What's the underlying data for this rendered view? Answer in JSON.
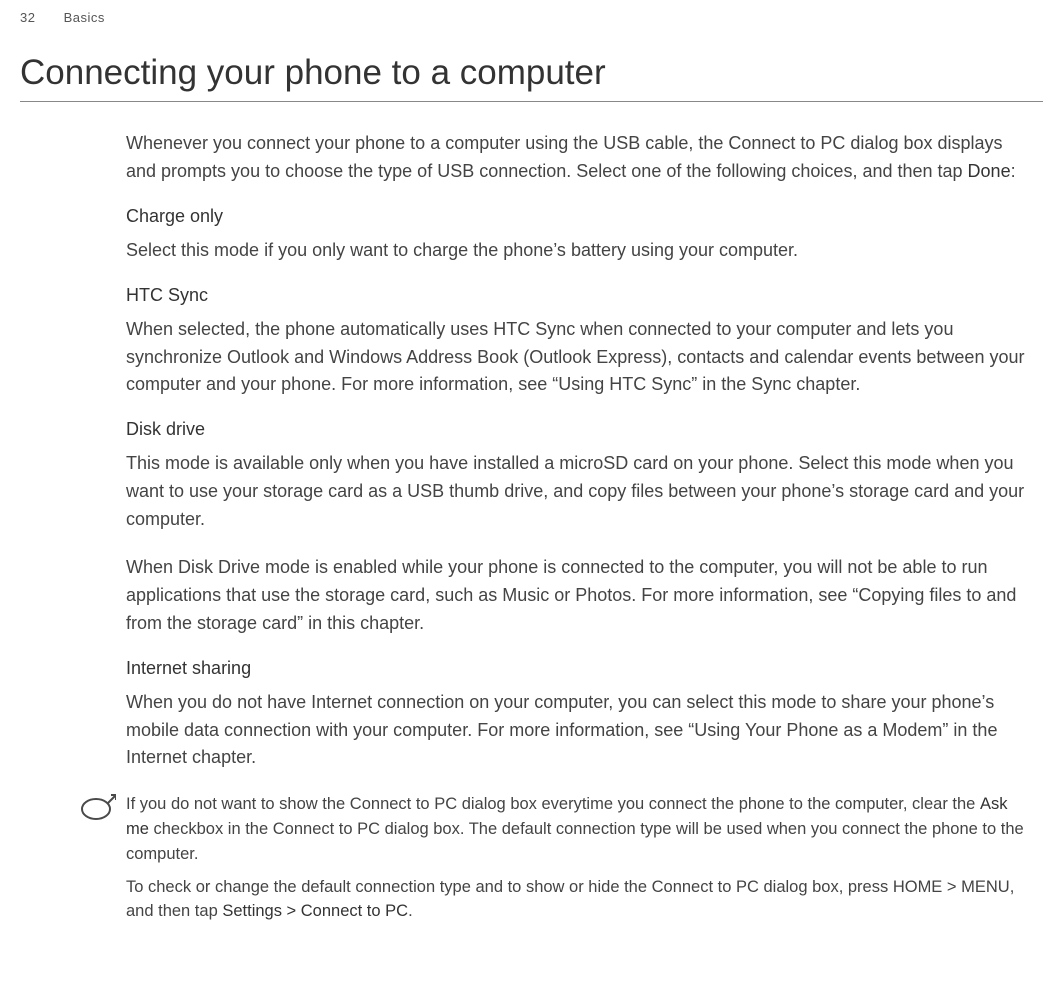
{
  "header": {
    "page_number": "32",
    "section": "Basics"
  },
  "title": "Connecting your phone to a computer",
  "intro": {
    "text_before": "Whenever you connect your phone to a computer using the USB cable, the Connect to PC dialog box displays and prompts you to choose the type of USB connection. Select one of the following choices, and then tap ",
    "strong": "Done",
    "text_after": ":"
  },
  "sections": {
    "charge": {
      "heading": "Charge only",
      "body": "Select this mode if you only want to charge the phone’s battery using your computer."
    },
    "sync": {
      "heading": "HTC Sync",
      "body": "When selected, the phone automatically uses HTC Sync when connected to your computer and lets you synchronize Outlook and Windows Address Book (Outlook Express), contacts and calendar events between your computer and your phone. For more information, see “Using HTC Sync” in the Sync chapter."
    },
    "disk": {
      "heading": "Disk drive",
      "body1": "This mode is available only when you have installed a microSD card on your phone. Select this mode when you want to use your storage card as a USB thumb drive, and copy files between your phone’s storage card and your computer.",
      "body2": "When Disk Drive mode is enabled while your phone is connected to the computer, you will not be able to run applications that use the storage card, such as Music or Photos. For more information, see “Copying files to and from the storage card” in this chapter."
    },
    "internet": {
      "heading": "Internet sharing",
      "body": "When you do not have Internet connection on your computer, you can select this mode to share your phone’s mobile data connection with your computer. For more information, see “Using Your Phone as a Modem” in the Internet chapter."
    }
  },
  "note": {
    "p1_before": "If you do not want to show the Connect to PC dialog box everytime you connect the phone to the computer, clear the ",
    "p1_strong": "Ask me",
    "p1_after": " checkbox in the Connect to PC dialog box. The default connection type will be used when you connect the phone to the computer.",
    "p2_before": "To check or change the default connection type and to show or hide the Connect to PC dialog box, press HOME > MENU, and then tap ",
    "p2_strong": "Settings > Connect to PC",
    "p2_after": "."
  }
}
